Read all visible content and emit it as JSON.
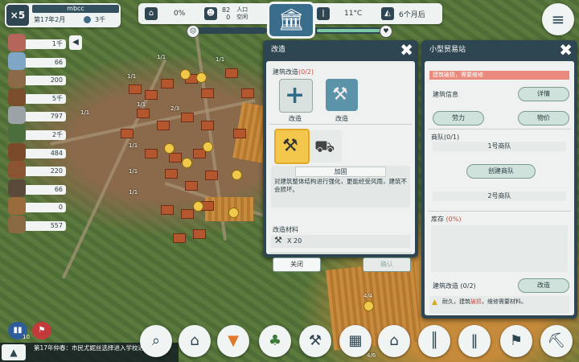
{
  "player": {
    "speed_label": "×5",
    "name": "mbcc",
    "date": "第17年2月",
    "coins": "3千"
  },
  "resources": [
    {
      "icon": "meat-icon",
      "value": "1千",
      "color": "#b5655a"
    },
    {
      "icon": "fish-icon",
      "value": "66",
      "color": "#7fa6c4"
    },
    {
      "icon": "fur-icon",
      "value": "200",
      "color": "#8c6a47"
    },
    {
      "icon": "log-icon",
      "value": "5千",
      "color": "#7a4d2c"
    },
    {
      "icon": "stone-icon",
      "value": "797",
      "color": "#9aa3a6"
    },
    {
      "icon": "herb-icon",
      "value": "2千",
      "color": "#4b6e3d"
    },
    {
      "icon": "firewood-icon",
      "value": "484",
      "color": "#7b4a2a"
    },
    {
      "icon": "coat-icon",
      "value": "220",
      "color": "#8a5331"
    },
    {
      "icon": "tool-icon",
      "value": "66",
      "color": "#5a4a3a"
    },
    {
      "icon": "ration-icon",
      "value": "0",
      "color": "#9a6b3d"
    },
    {
      "icon": "sack-icon",
      "value": "557",
      "color": "#8a6a42"
    }
  ],
  "topbar": {
    "happiness": "0%",
    "population_top": "82",
    "population_bottom": "0",
    "pop_label_1": "人口",
    "pop_label_2": "空闲",
    "temperature": "11°C",
    "season": "6个月后"
  },
  "modify_panel": {
    "title": "改造",
    "section_label": "建筑改造",
    "section_count": "(0/2)",
    "slot1_label": "改造",
    "slot2_label": "改造",
    "reinforce_label": "加固",
    "description": "对建筑整体结构进行强化，更能经受风雨，建筑不会损坏。",
    "materials_label": "改造材料",
    "material_amount": "X 20",
    "close_label": "关闭",
    "confirm_label": "确认"
  },
  "trade_panel": {
    "title": "小型贸易站",
    "warning": "建筑破损，需要维修",
    "building_info": "建筑信息",
    "details_btn": "详情",
    "labor_btn": "劳力",
    "prices_btn": "物价",
    "caravan_label": "商队",
    "caravan_count": "(0/1)",
    "caravan1": "1号商队",
    "create_btn": "创建商队",
    "caravan2": "2号商队",
    "storage_label": "库存",
    "storage_count": "(0%)",
    "modify_label": "建筑改造 (0/2)",
    "modify_btn": "改造",
    "repair_note_1": "耐久，建筑",
    "repair_note_red": "破损",
    "repair_note_2": "，维修需要材料。"
  },
  "bottom": {
    "news": "第17年仲春：市民尤妮丝选择进入学校进修。",
    "collapse_icon": "▲",
    "stat_count": "10"
  },
  "map_labels": [
    "1/1",
    "1/1",
    "1/1",
    "1/1",
    "1/1",
    "2/3",
    "1/1",
    "1/1",
    "1/1",
    "4/4",
    "4/6"
  ]
}
